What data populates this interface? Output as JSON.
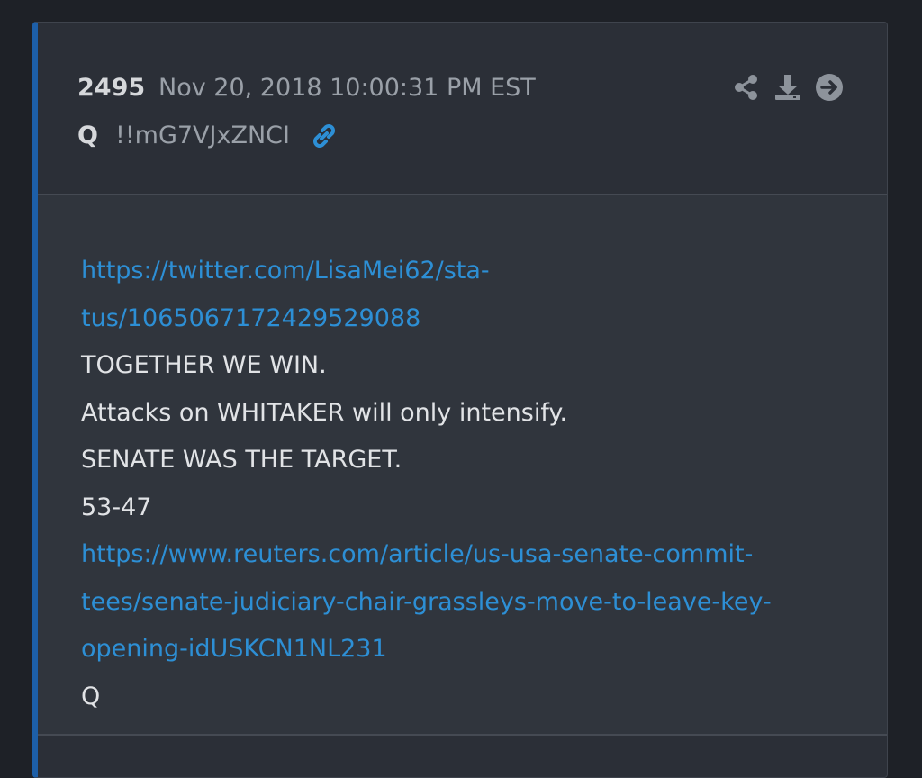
{
  "post": {
    "number": "2495",
    "timestamp": "Nov 20, 2018 10:00:31 PM EST",
    "author": "Q",
    "tripcode": "!!mG7VJxZNCI",
    "accent_color": "#1d5fa8",
    "link_color": "#2d8fd5",
    "actions": [
      "share-icon",
      "download-icon",
      "arrow-right-circle-icon"
    ],
    "body_lines": [
      {
        "text": "https://twitter.com/LisaMei62/sta-",
        "type": "link"
      },
      {
        "text": "tus/1065067172429529088",
        "type": "link"
      },
      {
        "text": "TOGETHER WE WIN.",
        "type": "text"
      },
      {
        "text": "Attacks on WHITAKER will only intensify.",
        "type": "text"
      },
      {
        "text": "SENATE WAS THE TARGET.",
        "type": "text"
      },
      {
        "text": "53-47",
        "type": "text"
      },
      {
        "text": "https://www.reuters.com/article/us-usa-senate-commit-",
        "type": "link"
      },
      {
        "text": "tees/senate-judiciary-chair-grassleys-move-to-leave-key-",
        "type": "link"
      },
      {
        "text": "opening-idUSKCN1NL231",
        "type": "link"
      },
      {
        "text": "Q",
        "type": "text"
      }
    ]
  }
}
